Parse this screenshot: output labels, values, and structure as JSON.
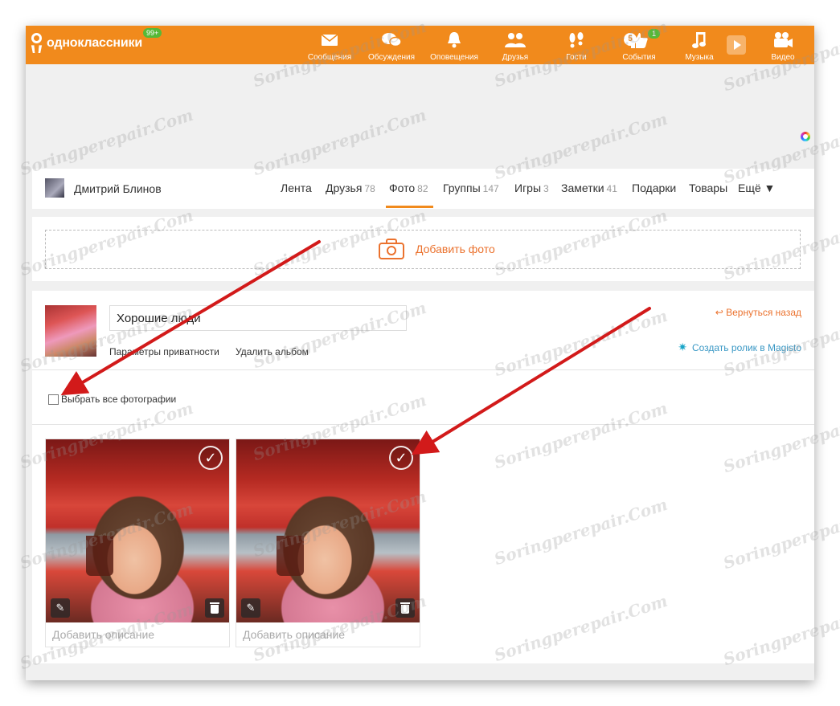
{
  "header": {
    "logo_text": "одноклассники",
    "logo_badge": "99+",
    "nav": [
      {
        "label": "Сообщения",
        "icon": "envelope-icon"
      },
      {
        "label": "Обсуждения",
        "icon": "chat-bubbles-icon"
      },
      {
        "label": "Оповещения",
        "icon": "bell-icon"
      },
      {
        "label": "Друзья",
        "icon": "people-icon"
      },
      {
        "label": "Гости",
        "icon": "footprints-icon"
      },
      {
        "label": "События",
        "icon": "like-icon",
        "count": "5",
        "badge": "1"
      },
      {
        "label": "Музыка",
        "icon": "music-note-icon"
      },
      {
        "label": "Видео",
        "icon": "video-camera-icon"
      }
    ]
  },
  "profile": {
    "name": "Дмитрий Блинов",
    "tabs": [
      {
        "label": "Лента",
        "count": ""
      },
      {
        "label": "Друзья",
        "count": "78"
      },
      {
        "label": "Фото",
        "count": "82"
      },
      {
        "label": "Группы",
        "count": "147"
      },
      {
        "label": "Игры",
        "count": "3"
      },
      {
        "label": "Заметки",
        "count": "41"
      },
      {
        "label": "Подарки",
        "count": ""
      },
      {
        "label": "Товары",
        "count": ""
      },
      {
        "label": "Ещё ▼",
        "count": ""
      }
    ],
    "active_tab": "Фото"
  },
  "add_photo": {
    "label": "Добавить фото"
  },
  "album": {
    "title": "Хорошие люди",
    "privacy_link": "Параметры приватности",
    "delete_link": "Удалить альбом",
    "back_link": "Вернуться назад",
    "magisto_link": "Создать ролик в Magisto",
    "select_all_label": "Выбрать все фотографии",
    "select_all_checked": false
  },
  "photos": [
    {
      "description_placeholder": "Добавить описание",
      "selected": false
    },
    {
      "description_placeholder": "Добавить описание",
      "selected": false
    }
  ],
  "watermark": "Soringperepair.Com",
  "colors": {
    "brand_orange": "#f18a1c",
    "link_orange": "#eb722e",
    "badge_green": "#56b937",
    "magisto_blue": "#3a98c5",
    "annotation_arrow": "#d21a1a"
  }
}
